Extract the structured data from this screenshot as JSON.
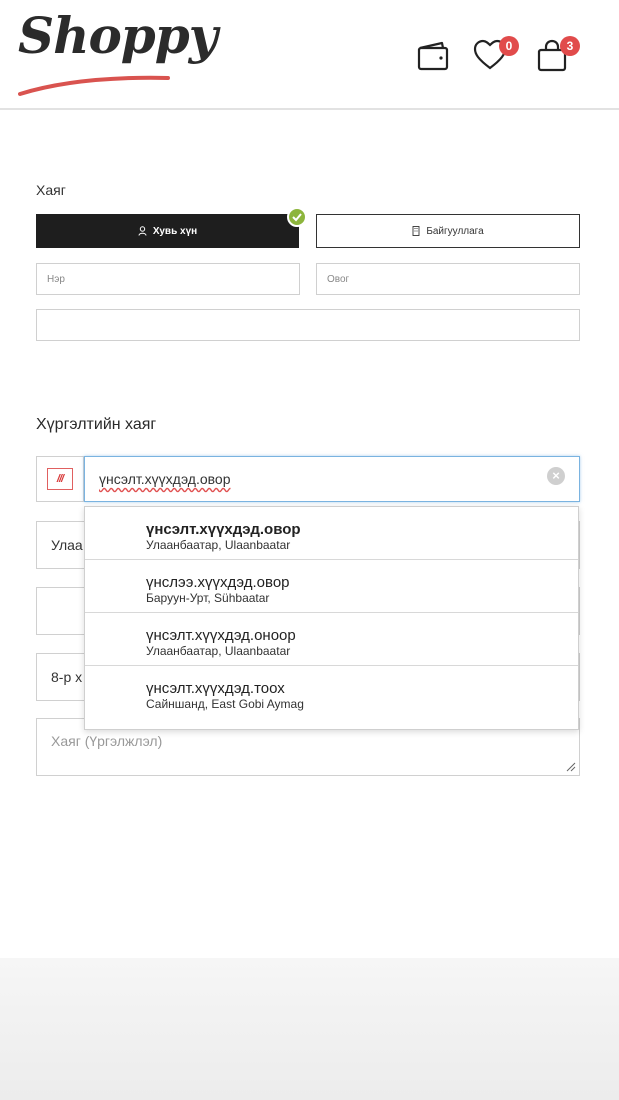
{
  "brand": {
    "name": "Shoppy",
    "accent": "#d9534f"
  },
  "header": {
    "wallet_icon": "wallet-icon",
    "wishlist": {
      "icon": "heart-icon",
      "count": "0"
    },
    "cart": {
      "icon": "shopping-bag-icon",
      "count": "3"
    }
  },
  "address_section": {
    "title": "Хаяг",
    "type_tabs": [
      {
        "label": "Хувь хүн",
        "icon": "user-icon",
        "active": true
      },
      {
        "label": "Байгууллага",
        "icon": "building-icon",
        "active": false
      }
    ],
    "first_name_placeholder": "Нэр",
    "last_name_placeholder": "Овог",
    "extra_field_value": ""
  },
  "delivery_section": {
    "title": "Хүргэлтийн хаяг",
    "country_flag": "///",
    "search_value": "үнсэлт.хүүхдэд.овор",
    "suggestions": [
      {
        "main": "үнсэлт.хүүхдэд.овор",
        "sub": "Улаанбаатар, Ulaanbaatar"
      },
      {
        "main": "үнслээ.хүүхдэд.овор",
        "sub": "Баруун-Урт, Sühbaatar"
      },
      {
        "main": "үнсэлт.хүүхдэд.оноор",
        "sub": "Улаанбаатар, Ulaanbaatar"
      },
      {
        "main": "үнсэлт.хүүхдэд.тоох",
        "sub": "Сайншанд, East Gobi Aymag"
      }
    ],
    "city_value_partial": "Улаа",
    "district_value_partial": "8-р х",
    "address_extra_placeholder": "Хаяг (Үргэлжлэл)"
  }
}
